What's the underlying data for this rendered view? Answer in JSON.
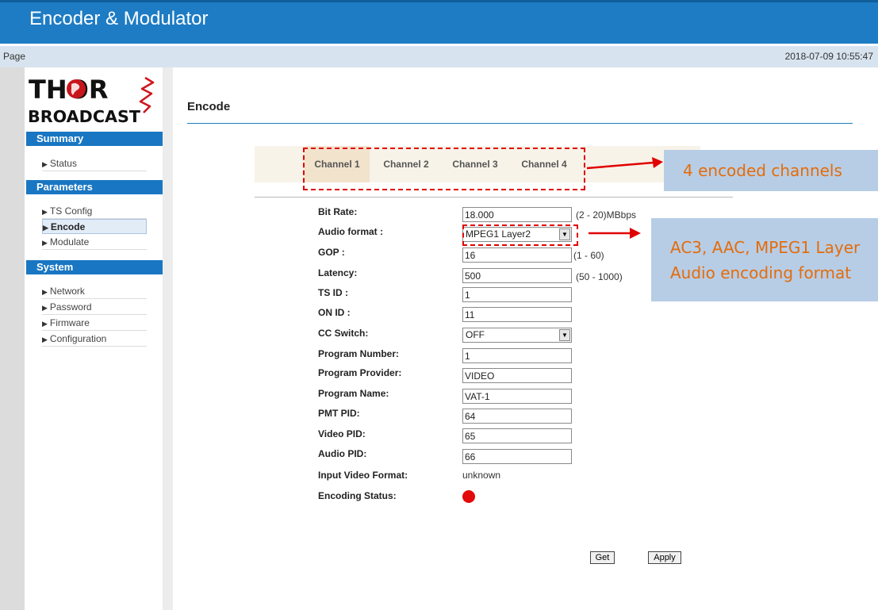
{
  "header": {
    "title": "Encoder & Modulator"
  },
  "subbar": {
    "page_label": "Page",
    "timestamp": "2018-07-09 10:55:47"
  },
  "logo": {
    "line1": "THOR",
    "line2": "BROADCAST"
  },
  "sidebar": {
    "sections": [
      {
        "title": "Summary",
        "items": [
          {
            "label": "Status"
          }
        ]
      },
      {
        "title": "Parameters",
        "items": [
          {
            "label": "TS Config"
          },
          {
            "label": "Encode"
          },
          {
            "label": "Modulate"
          }
        ]
      },
      {
        "title": "System",
        "items": [
          {
            "label": "Network"
          },
          {
            "label": "Password"
          },
          {
            "label": "Firmware"
          },
          {
            "label": "Configuration"
          }
        ]
      }
    ],
    "active_item": "Encode"
  },
  "main": {
    "title": "Encode",
    "tabs": [
      {
        "label": "Channel 1"
      },
      {
        "label": "Channel 2"
      },
      {
        "label": "Channel 3"
      },
      {
        "label": "Channel 4"
      }
    ],
    "active_tab": "Channel 1",
    "fields": {
      "bit_rate": {
        "label": "Bit Rate:",
        "value": "18.000",
        "hint": "(2 - 20)MBbps"
      },
      "audio_format": {
        "label": "Audio format :",
        "value": "MPEG1 Layer2"
      },
      "gop": {
        "label": "GOP :",
        "value": "16",
        "hint": "(1 - 60)"
      },
      "latency": {
        "label": "Latency:",
        "value": "500",
        "hint": "(50 - 1000)"
      },
      "ts_id": {
        "label": "TS ID :",
        "value": "1"
      },
      "on_id": {
        "label": "ON ID :",
        "value": "11"
      },
      "cc_switch": {
        "label": "CC Switch:",
        "value": "OFF"
      },
      "program_number": {
        "label": "Program Number:",
        "value": "1"
      },
      "program_provider": {
        "label": "Program Provider:",
        "value": "VIDEO"
      },
      "program_name": {
        "label": "Program Name:",
        "value": "VAT-1"
      },
      "pmt_pid": {
        "label": "PMT PID:",
        "value": "64"
      },
      "video_pid": {
        "label": "Video PID:",
        "value": "65"
      },
      "audio_pid": {
        "label": "Audio PID:",
        "value": "66"
      },
      "input_video_format": {
        "label": "Input Video Format:",
        "value": "unknown"
      },
      "encoding_status": {
        "label": "Encoding Status:",
        "status_color": "#e20a0a"
      }
    },
    "buttons": {
      "get": "Get",
      "apply": "Apply"
    }
  },
  "annotations": {
    "channels_note": "4 encoded channels",
    "audio_note_line1": "AC3, AAC, MPEG1 Layer",
    "audio_note_line2": "Audio encoding format"
  },
  "colors": {
    "accent": "#1e7cc4",
    "annotation_red": "#e00000",
    "callout_bg": "#b7cde6",
    "callout_text": "#e46c0a"
  }
}
